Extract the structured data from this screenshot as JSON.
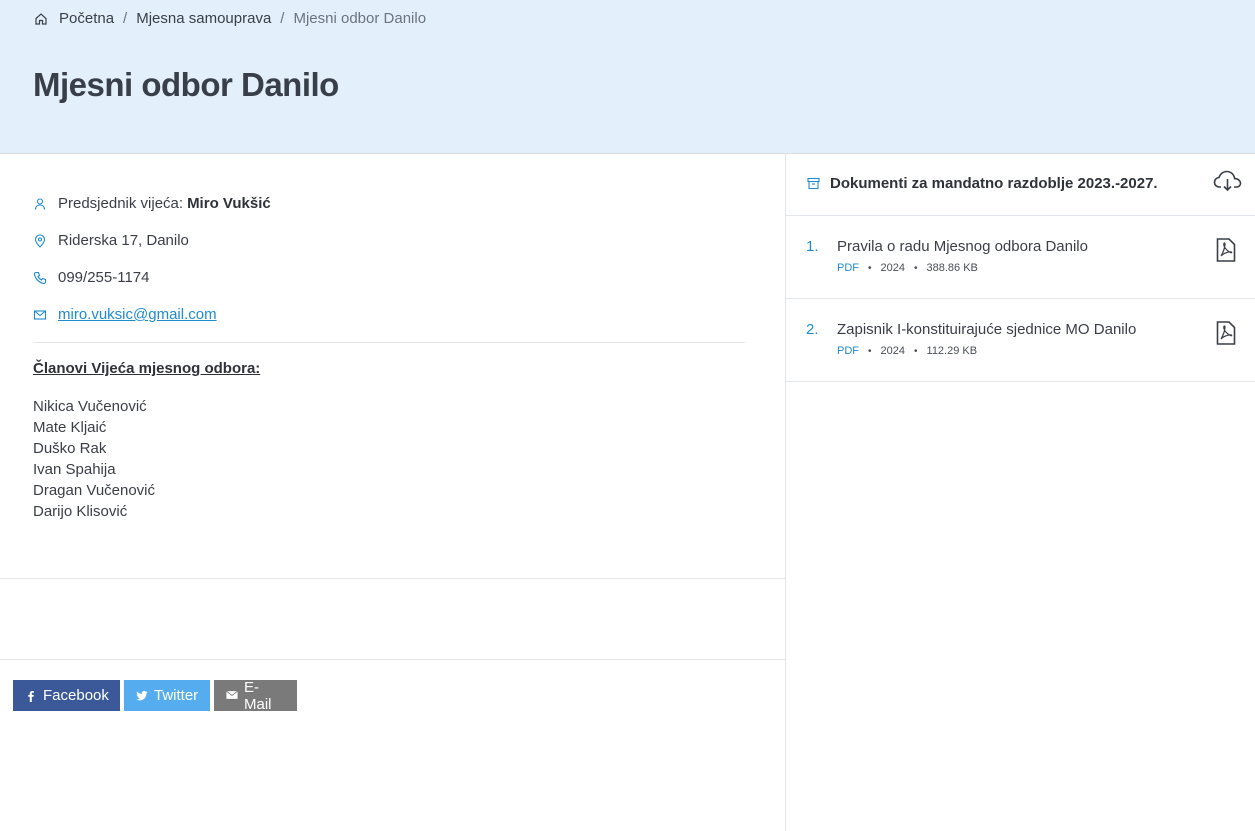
{
  "breadcrumb": {
    "home": "Početna",
    "level2": "Mjesna samouprava",
    "current": "Mjesni odbor Danilo",
    "separator": "/"
  },
  "page": {
    "title": "Mjesni odbor Danilo"
  },
  "contact": {
    "president_label": "Predsjednik vijeća:",
    "president_name": "Miro Vukšić",
    "address": "Riderska 17, Danilo",
    "phone": "099/255-1174",
    "email": "miro.vuksic@gmail.com"
  },
  "members": {
    "title": "Članovi Vijeća mjesnog odbora:",
    "list": [
      "Nikica Vučenović",
      "Mate Kljaić",
      "Duško Rak",
      "Ivan Spahija",
      "Dragan Vučenović",
      "Darijo Klisović"
    ]
  },
  "share": {
    "facebook": "Facebook",
    "twitter": "Twitter",
    "email": "E-Mail"
  },
  "documents": {
    "title": "Dokumenti za mandatno razdoblje 2023.-2027.",
    "items": [
      {
        "num": "1.",
        "title": "Pravila o radu Mjesnog odbora Danilo",
        "type": "PDF",
        "year": "2024",
        "size": "388.86 KB"
      },
      {
        "num": "2.",
        "title": "Zapisnik I-konstituirajuće sjednice MO Danilo",
        "type": "PDF",
        "year": "2024",
        "size": "112.29 KB"
      }
    ]
  },
  "colors": {
    "hero_bg": "#e3f0fb",
    "link": "#1f8bd1",
    "facebook": "#3b5998",
    "twitter": "#55acee",
    "email": "#7a7a7a"
  },
  "icons": [
    "home-icon",
    "user-icon",
    "map-pin-icon",
    "phone-icon",
    "mail-icon",
    "archive-box-icon",
    "cloud-download-icon",
    "pdf-file-icon",
    "facebook-icon",
    "twitter-icon",
    "envelope-icon"
  ]
}
